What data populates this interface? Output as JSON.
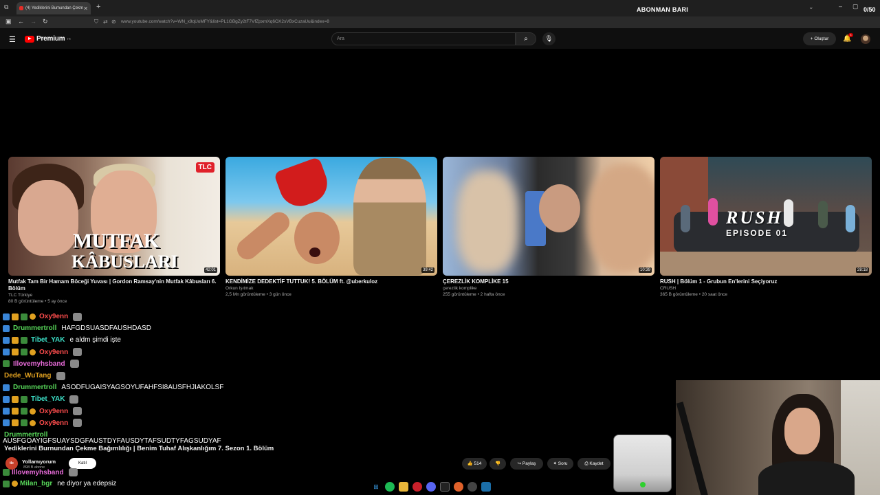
{
  "browser": {
    "tab_title": "(4) Yediklerini Bumundan Çekm",
    "address": "www.youtube.com/watch?v=WN_x9qUoMFY&list=PL1GBgZy2tF7VfZpxmXq6OX2sVBxCuzaUu&index=8",
    "overlay_title": "ABONMAN BARI",
    "overlay_counter": "0/50"
  },
  "youtube": {
    "logo": "Premium",
    "logo_tm": "TR",
    "search_placeholder": "Ara",
    "create_label": "+ Oluştur",
    "notif_count": "4"
  },
  "videos": [
    {
      "title": "Mutfak Tam Bir Hamam Böceği Yuvası | Gordon Ramsay'nin Mutfak Kâbusları 6. Bölüm",
      "channel": "TLC Türkiye",
      "meta": "80 B görüntüleme • 5 ay önce",
      "duration": "42:01",
      "thumb_text_1": "MUTFAK",
      "thumb_text_2": "KÂBUSLARI",
      "badge": "TLC"
    },
    {
      "title": "KENDİMİZE DEDEKTİF TUTTUK! 5. BÖLÜM ft. @uberkuloz",
      "channel": "Orkun Işıtmak",
      "meta": "2,5 Mn görüntüleme • 3 gün önce",
      "duration": "39:42"
    },
    {
      "title": "ÇEREZLİK KOMPLİKE 15",
      "channel": "çerezlik komplike",
      "meta": "255 görüntüleme • 2 hafta önce",
      "duration": "10:39"
    },
    {
      "title": "RUSH | Bölüm 1 - Grubun En'lerini Seçiyoruz",
      "channel": "CRUSH",
      "meta": "365 B görüntüleme • 20 saat önce",
      "duration": "28:18",
      "thumb_text_1": "RUSH",
      "thumb_text_2": "EPISODE 01"
    }
  ],
  "chat": [
    {
      "user": "Oxy9enn",
      "color": "#ff4d4d",
      "text": "",
      "badges": [
        "blue",
        "gold",
        "green",
        "circle"
      ],
      "emote": true
    },
    {
      "user": "Drummertroll",
      "color": "#58d85a",
      "text": "HAFGDSUASDFAUSHDASD",
      "badges": [
        "blue"
      ],
      "emote": false
    },
    {
      "user": "Tibet_YAK",
      "color": "#3de0c8",
      "text": "e aldm şimdi işte",
      "badges": [
        "blue",
        "gold",
        "green"
      ],
      "emote": false
    },
    {
      "user": "Oxy9enn",
      "color": "#ff4d4d",
      "text": "",
      "badges": [
        "blue",
        "gold",
        "green",
        "circle"
      ],
      "emote": true
    },
    {
      "user": "Illovemyhsband",
      "color": "#e66bd8",
      "text": "",
      "badges": [
        "green"
      ],
      "emote": true
    },
    {
      "user": "Dede_WuTang",
      "color": "#e0a020",
      "text": "",
      "badges": [],
      "emote": true
    },
    {
      "user": "Drummertroll",
      "color": "#58d85a",
      "text": "ASODFUGAISYAGSOYUFAHFSI8AUSFHJIAKOLSF",
      "badges": [
        "blue"
      ],
      "emote": false
    },
    {
      "user": "Tibet_YAK",
      "color": "#3de0c8",
      "text": "",
      "badges": [
        "blue",
        "gold",
        "green"
      ],
      "emote": true
    },
    {
      "user": "Oxy9enn",
      "color": "#ff4d4d",
      "text": "",
      "badges": [
        "blue",
        "gold",
        "green",
        "circle"
      ],
      "emote": true
    },
    {
      "user": "Oxy9enn",
      "color": "#ff4d4d",
      "text": "",
      "badges": [
        "blue",
        "gold",
        "green",
        "circle"
      ],
      "emote": true
    },
    {
      "user": "Drummertroll",
      "color": "#58d85a",
      "text": "",
      "badges": [],
      "emote": false
    }
  ],
  "chat_long": "AUSFGOAYIGFSUAYSDGFAUSTDYFAUSDYTAFSUDTYFAGSUDYAF",
  "video_title": "Yediklerini Burnundan Çekme Bağımlılığı | Benim Tuhaf Alışkanlığım 7. Sezon 1. Bölüm",
  "channel": {
    "name": "Yollamıyorum",
    "subs": "898 B abone",
    "join": "Katıl",
    "avatar": "tlc"
  },
  "chat_after": [
    {
      "user": "Illovemyhsband",
      "color": "#e66bd8",
      "text": ""
    },
    {
      "user": "Milan_bgr",
      "color": "#58d85a",
      "text": "ne diyor ya edepsiz"
    }
  ],
  "actions": {
    "likes": "514",
    "share": "Paylaş",
    "ask": "Soru",
    "save": "Kaydet"
  }
}
